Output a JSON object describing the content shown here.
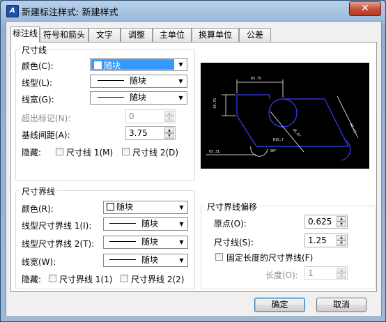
{
  "window": {
    "title": "新建标注样式: 新建样式",
    "close_glyph": "✕",
    "app_icon": "autocad-icon",
    "app_glyph": "A"
  },
  "tabs": [
    "标注线",
    "符号和箭头",
    "文字",
    "调整",
    "主单位",
    "换算单位",
    "公差"
  ],
  "dimline": {
    "group_title": "尺寸线",
    "color_label": "颜色(C):",
    "color_value": "随块",
    "linetype_label": "线型(L):",
    "linetype_value": "随块",
    "lineweight_label": "线宽(G):",
    "lineweight_value": "随块",
    "extend_label": "超出标记(N):",
    "extend_value": "0",
    "baseline_label": "基线间距(A):",
    "baseline_value": "3.75",
    "suppress_label": "隐藏:",
    "suppress_1": "尺寸线 1(M)",
    "suppress_2": "尺寸线 2(D)"
  },
  "extline": {
    "group_title": "尺寸界线",
    "color_label": "颜色(R):",
    "color_value": "随块",
    "linetype1_label": "线型尺寸界线 1(I):",
    "linetype1_value": "随块",
    "linetype2_label": "线型尺寸界线 2(T):",
    "linetype2_value": "随块",
    "lineweight_label": "线宽(W):",
    "lineweight_value": "随块",
    "suppress_label": "隐藏:",
    "suppress_1": "尺寸界线 1(1)",
    "suppress_2": "尺寸界线 2(2)"
  },
  "offset": {
    "group_title": "尺寸界线偏移",
    "origin_label": "原点(O):",
    "origin_value": "0.625",
    "dimline_label": "尺寸线(S):",
    "dimline_value": "1.25",
    "fixed_label": "固定长度的尺寸界线(F)",
    "length_label": "长度(O):",
    "length_value": "1"
  },
  "preview": {
    "dim_top": "65.75",
    "dim_left": "34.76",
    "dim_right": "60.11",
    "dim_angle": "45.0°",
    "dim_radius": "R15.7",
    "dim_bottom": "65.31",
    "dim_arc": "90°"
  },
  "buttons": {
    "ok": "确定",
    "cancel": "取消"
  },
  "colors": {
    "accent": "#3399ff",
    "preview_bg": "#000000",
    "geometry": "#3c3cff",
    "dims": "#ffffff"
  }
}
